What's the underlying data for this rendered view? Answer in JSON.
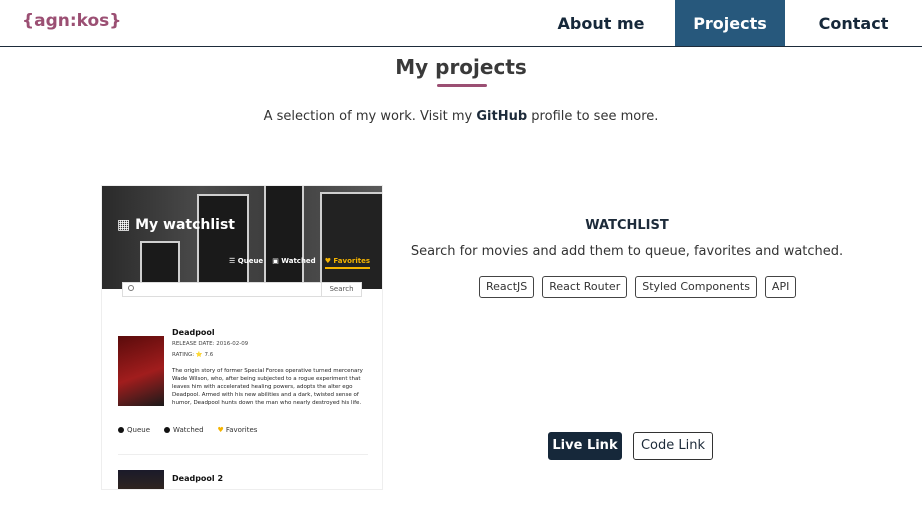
{
  "header": {
    "logo": "{agn:kos}",
    "nav": [
      {
        "label": "About me"
      },
      {
        "label": "Projects"
      },
      {
        "label": "Contact"
      }
    ]
  },
  "section": {
    "title": "My projects",
    "subtitle_pre": "A selection of my work. Visit my ",
    "subtitle_link": "GitHub",
    "subtitle_post": " profile to see more."
  },
  "screenshot": {
    "app_title": "My watchlist",
    "tabs": [
      "Queue",
      "Watched",
      "Favorites"
    ],
    "search_button": "Search",
    "movies": [
      {
        "title": "Deadpool",
        "release": "RELEASE DATE: 2016-02-09",
        "rating": "RATING: ⭐ 7.6",
        "description": "The origin story of former Special Forces operative turned mercenary Wade Wilson, who, after being subjected to a rogue experiment that leaves him with accelerated healing powers, adopts the alter ego Deadpool. Armed with his new abilities and a dark, twisted sense of humor, Deadpool hunts down the man who nearly destroyed his life.",
        "actions": [
          "Queue",
          "Watched",
          "Favorites"
        ]
      },
      {
        "title": "Deadpool 2"
      }
    ]
  },
  "project": {
    "name": "WATCHLIST",
    "description": "Search for movies and add them to queue, favorites and watched.",
    "tags": [
      "ReactJS",
      "React Router",
      "Styled Components",
      "API"
    ],
    "live_label": "Live Link",
    "code_label": "Code Link"
  },
  "colors": {
    "accent": "#9b4f73",
    "nav_active": "#27587c",
    "dark": "#16283a"
  }
}
